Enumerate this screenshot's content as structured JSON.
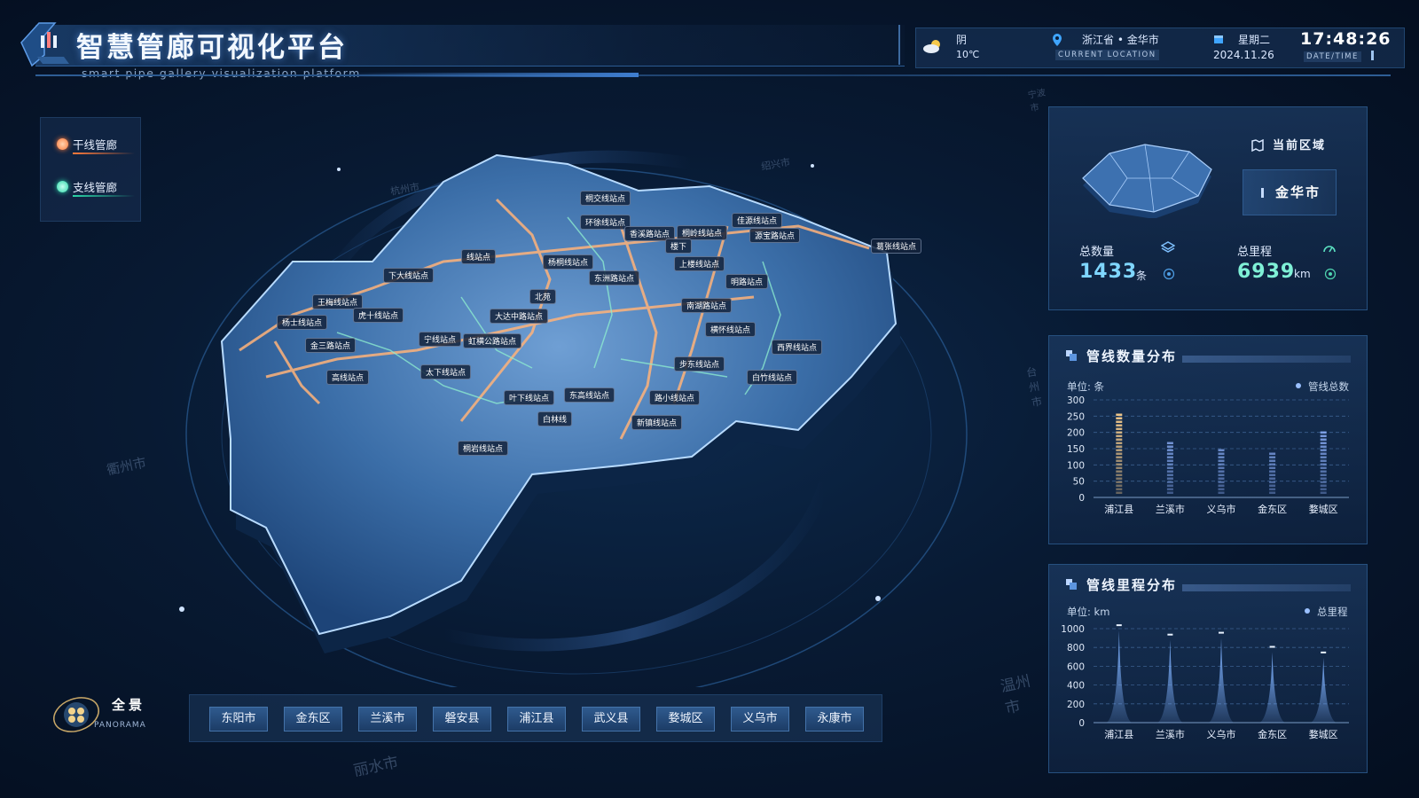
{
  "header": {
    "title": "智慧管廊可视化平台",
    "subtitle": "smart pipe gallery visualization platform",
    "weather": {
      "condition": "阴",
      "temp": "10℃",
      "icon": "cloudy-icon"
    },
    "location": {
      "name": "浙江省 • 金华市",
      "tag": "CURRENT LOCATION"
    },
    "date": {
      "weekday": "星期二",
      "date": "2024.11.26"
    },
    "time": {
      "value": "17:48:26",
      "tag": "DATE/TIME"
    }
  },
  "legend": {
    "items": [
      {
        "label": "干线管廊",
        "color": "#ff9a5c"
      },
      {
        "label": "支线管廊",
        "color": "#58e6c0"
      }
    ]
  },
  "map": {
    "stations": [
      {
        "label": "桐交线站点"
      },
      {
        "label": "环徐线站点"
      },
      {
        "label": "香溪路站点"
      },
      {
        "label": "桐岭线站点"
      },
      {
        "label": "佳源线站点"
      },
      {
        "label": "源宝路站点"
      },
      {
        "label": "楼下"
      },
      {
        "label": "葛张线站点"
      },
      {
        "label": "线站点"
      },
      {
        "label": "杨桐线站点"
      },
      {
        "label": "上楼线站点"
      },
      {
        "label": "下大线站点"
      },
      {
        "label": "东洲路站点"
      },
      {
        "label": "明路站点"
      },
      {
        "label": "王梅线站点"
      },
      {
        "label": "北苑"
      },
      {
        "label": "南湖路站点"
      },
      {
        "label": "虎十线站点"
      },
      {
        "label": "大达中路站点"
      },
      {
        "label": "杨士线站点"
      },
      {
        "label": "金三路站点"
      },
      {
        "label": "宁线站点"
      },
      {
        "label": "虹横公路站点"
      },
      {
        "label": "横怀线站点"
      },
      {
        "label": "西界线站点"
      },
      {
        "label": "太下线站点"
      },
      {
        "label": "步东线站点"
      },
      {
        "label": "高线站点"
      },
      {
        "label": "白竹线站点"
      },
      {
        "label": "叶下线站点"
      },
      {
        "label": "东高线站点"
      },
      {
        "label": "路小线站点"
      },
      {
        "label": "白林线"
      },
      {
        "label": "新镇线站点"
      },
      {
        "label": "桐岩线站点"
      }
    ],
    "city_labels": [
      "杭州市",
      "绍兴市",
      "宁波市",
      "衢州市",
      "温州市",
      "丽水市",
      "台州市"
    ]
  },
  "region_panel": {
    "title": "当前区域",
    "current": "金华市",
    "total_count_label": "总数量",
    "total_count": "1433",
    "total_count_unit": "条",
    "total_length_label": "总里程",
    "total_length": "6939",
    "total_length_unit": "km"
  },
  "count_panel": {
    "title": "管线数量分布",
    "unit": "单位: 条",
    "legend": "管线总数"
  },
  "length_panel": {
    "title": "管线里程分布",
    "unit": "单位: km",
    "legend": "总里程"
  },
  "chart_data": [
    {
      "type": "bar",
      "title": "管线数量分布",
      "categories": [
        "浦江县",
        "兰溪市",
        "义乌市",
        "金东区",
        "婺城区"
      ],
      "series": [
        {
          "name": "管线总数",
          "values": [
            260,
            170,
            145,
            135,
            200
          ]
        }
      ],
      "ylim": [
        0,
        300
      ],
      "yticks": [
        0,
        50,
        100,
        150,
        200,
        250,
        300
      ],
      "ylabel": "单位: 条",
      "grid": true,
      "legend_position": "top-right",
      "colors": {
        "highlight": "#f4c98a",
        "normal": "#8fb3ff"
      }
    },
    {
      "type": "area",
      "title": "管线里程分布",
      "categories": [
        "浦江县",
        "兰溪市",
        "义乌市",
        "金东区",
        "婺城区"
      ],
      "series": [
        {
          "name": "总里程",
          "values": [
            980,
            880,
            900,
            750,
            690
          ]
        }
      ],
      "ylim": [
        0,
        1000
      ],
      "yticks": [
        0,
        200,
        400,
        600,
        800,
        1000
      ],
      "ylabel": "单位: km",
      "grid": true,
      "legend_position": "top-right",
      "colors": {
        "peak": "#7fb2ff"
      }
    }
  ],
  "footer": {
    "panorama": {
      "label": "全景",
      "sub": "PANORAMA"
    },
    "districts": [
      "东阳市",
      "金东区",
      "兰溪市",
      "磐安县",
      "浦江县",
      "武义县",
      "婺城区",
      "义乌市",
      "永康市"
    ]
  }
}
